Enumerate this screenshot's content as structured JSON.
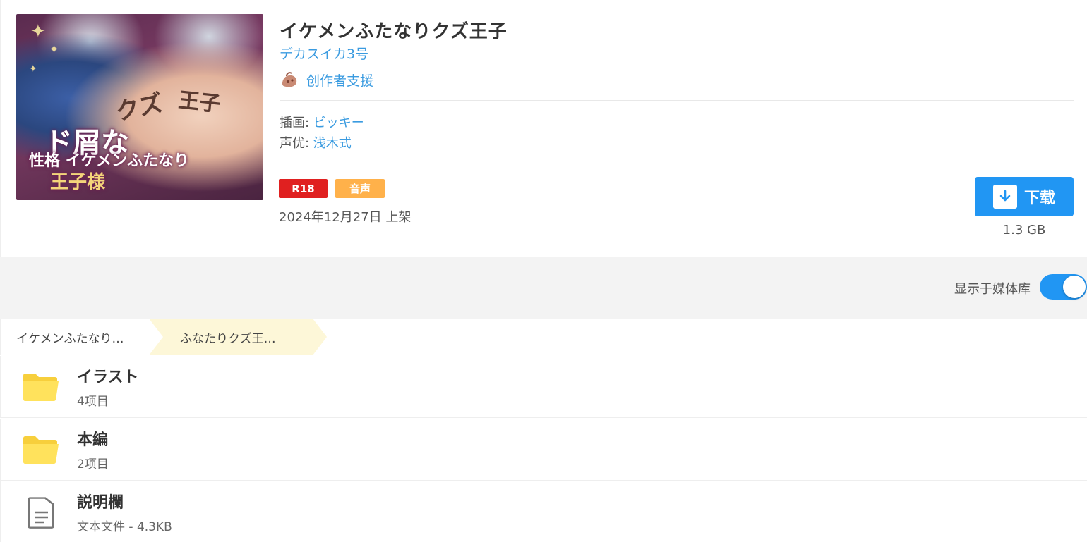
{
  "work": {
    "title": "イケメンふたなりクズ王子",
    "circle": "デカスイカ3号",
    "support_label": "创作者支援",
    "credits": [
      {
        "label": "插画: ",
        "value": "ビッキー"
      },
      {
        "label": "声优: ",
        "value": "浅木式"
      }
    ],
    "tags": [
      "R18",
      "音声"
    ],
    "release": "2024年12月27日 上架",
    "cover_art": {
      "text_k1": "クズ",
      "text_k2": "王子",
      "text_k3": "ド屑な",
      "text_k4": "性格 イケメンふたなり",
      "text_k5": "王子様"
    }
  },
  "download": {
    "label": "下载",
    "size": "1.3 GB"
  },
  "media_toggle": {
    "label": "显示于媒体库",
    "on": true
  },
  "breadcrumb": [
    "イケメンふたなり…",
    "ふなたりクズ王…"
  ],
  "files": [
    {
      "name": "イラスト",
      "meta": "4项目",
      "icon": "folder-icon"
    },
    {
      "name": "本編",
      "meta": "2项目",
      "icon": "folder-icon"
    },
    {
      "name": "説明欄",
      "meta": "文本文件 - 4.3KB",
      "icon": "document-icon"
    }
  ],
  "colors": {
    "accent": "#2196f3",
    "link": "#3a9be0",
    "r18": "#e02020",
    "voice": "#ffb14a",
    "folder": "#ffe25c",
    "crumb_active": "#fdf7d8"
  }
}
